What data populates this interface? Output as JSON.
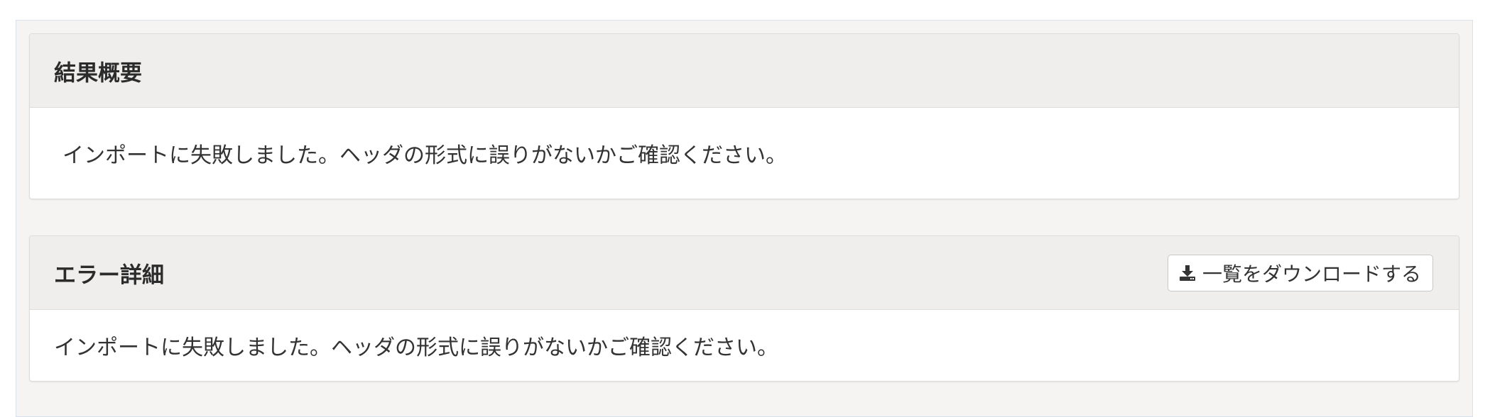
{
  "summary_panel": {
    "title": "結果概要",
    "message": "インポートに失敗しました。ヘッダの形式に誤りがないかご確認ください。"
  },
  "error_panel": {
    "title": "エラー詳細",
    "download_button": {
      "icon": "download-icon",
      "label": "一覧をダウンロードする"
    },
    "message": "インポートに失敗しました。ヘッダの形式に誤りがないかご確認ください。"
  }
}
